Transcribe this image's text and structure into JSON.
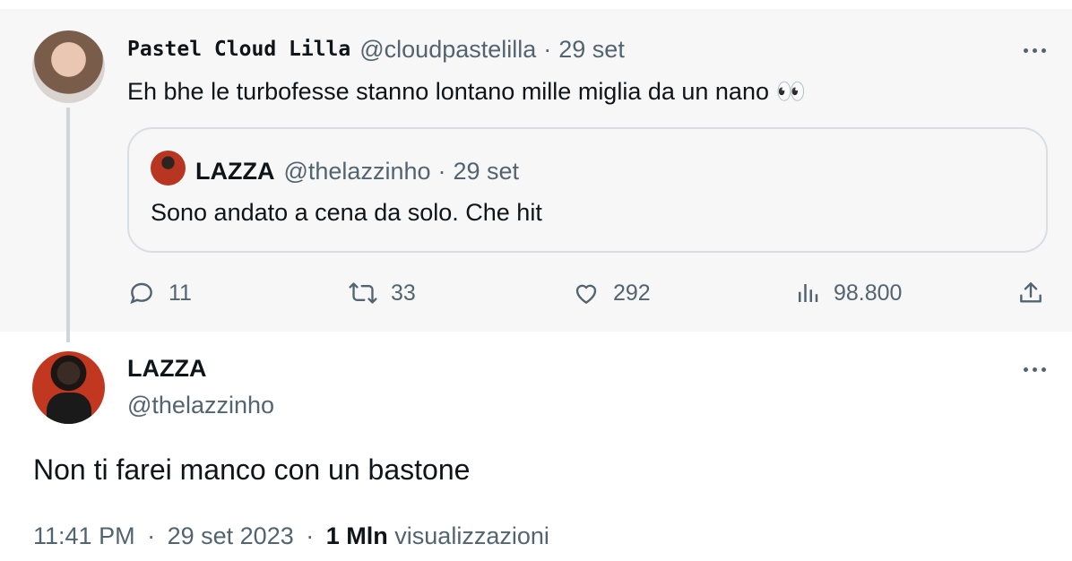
{
  "parent_tweet": {
    "display_name": "Pastel Cloud Lilla",
    "handle": "@cloudpastelilla",
    "separator": "·",
    "date": "29 set",
    "text": "Eh bhe le turbofesse stanno lontano mille miglia da un nano 👀",
    "quoted": {
      "display_name": "LAZZA",
      "handle": "@thelazzinho",
      "separator": "·",
      "date": "29 set",
      "text": "Sono andato a cena da solo. Che hit"
    },
    "actions": {
      "replies": "11",
      "retweets": "33",
      "likes": "292",
      "views": "98.800"
    }
  },
  "main_tweet": {
    "display_name": "LAZZA",
    "handle": "@thelazzinho",
    "text": "Non ti farei manco con un bastone",
    "time": "11:41 PM",
    "date": "29 set 2023",
    "views_count": "1 Mln",
    "views_label": "visualizzazioni",
    "separator": "·"
  },
  "icons": [
    "more-icon",
    "reply-icon",
    "retweet-icon",
    "like-icon",
    "views-icon",
    "share-icon"
  ],
  "colors": {
    "secondary_text": "#536471",
    "primary_text": "#0f1419",
    "parent_bg": "#f7f7f7"
  }
}
